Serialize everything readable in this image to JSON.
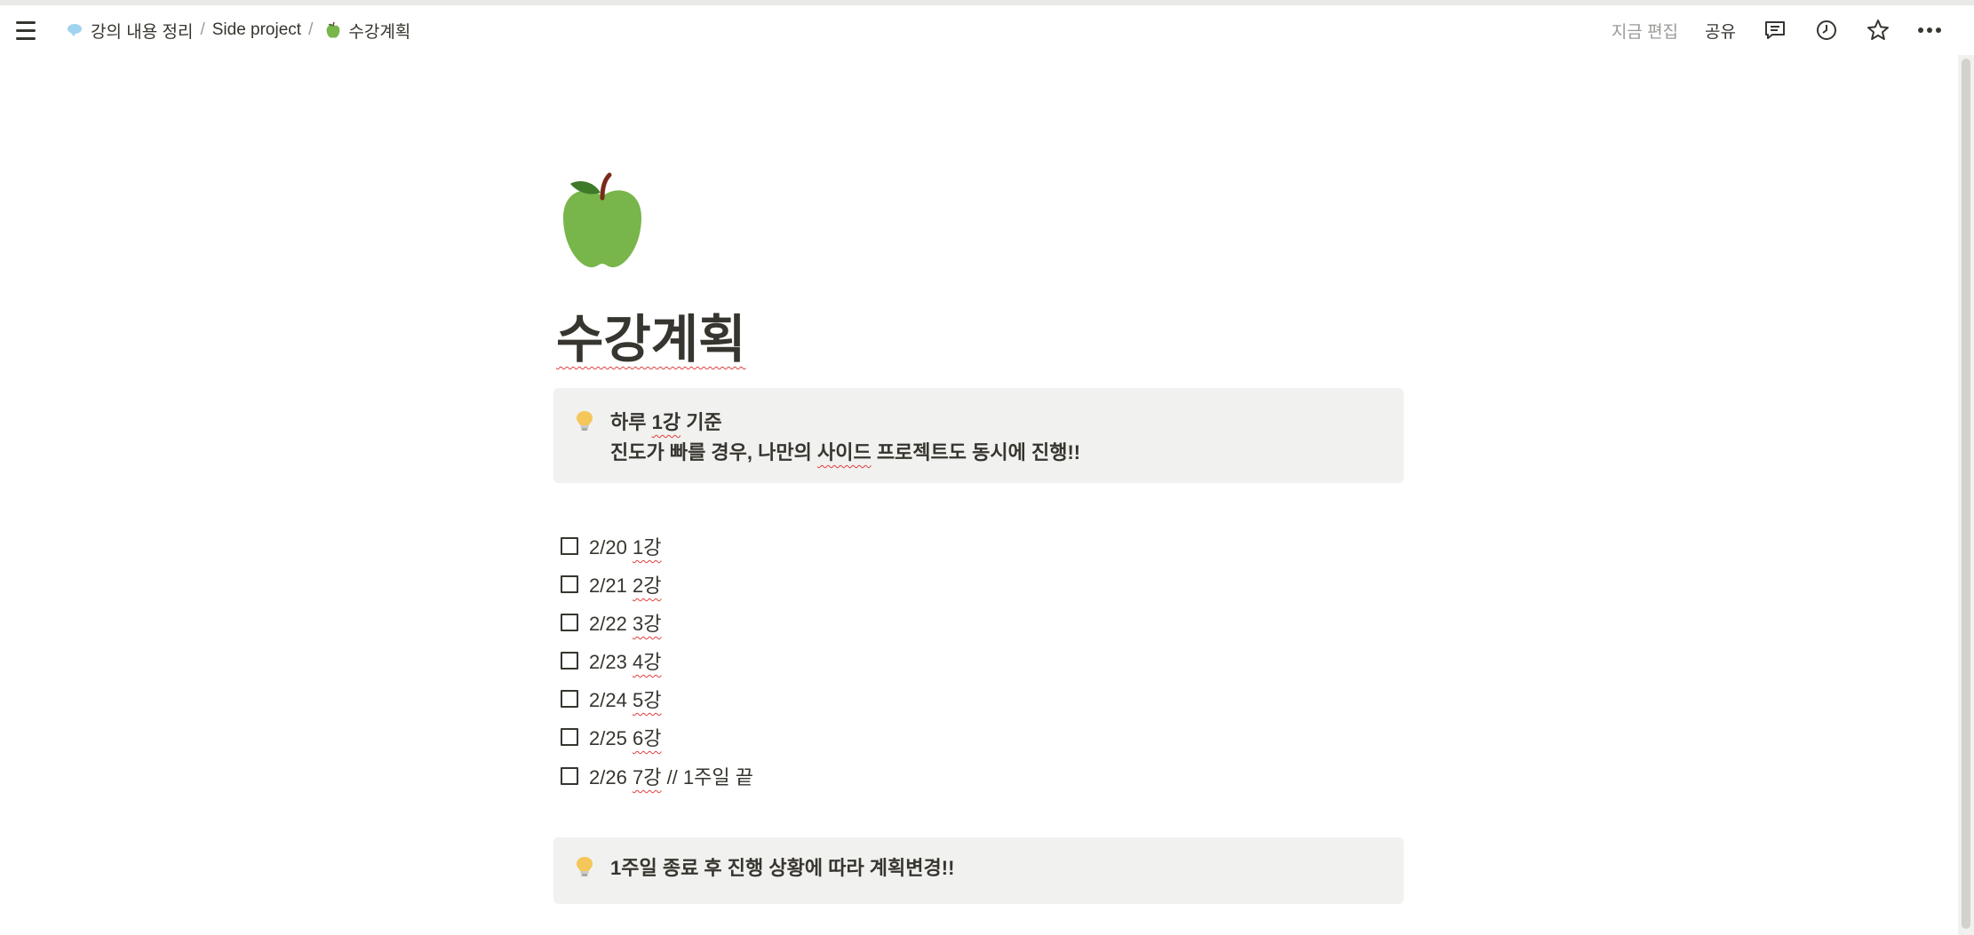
{
  "breadcrumb": {
    "items": [
      {
        "label": "강의 내용 정리",
        "icon": "speech-bubble-icon"
      },
      {
        "label": "Side project",
        "icon": ""
      },
      {
        "label": "수강계획",
        "icon": "green-apple-icon"
      }
    ],
    "separator": "/"
  },
  "topbar": {
    "edit_label": "지금 편집",
    "share_label": "공유",
    "icons": [
      "comment-icon",
      "clock-icon",
      "star-icon",
      "more-icon"
    ]
  },
  "page": {
    "icon": "green-apple",
    "title": "수강계획",
    "callout1": {
      "icon": "lightbulb-icon",
      "line1_prefix": "하루 ",
      "line1_mark": "1강",
      "line1_suffix": " 기준",
      "line2_prefix": "진도가 빠를 경우, 나만의 ",
      "line2_mark": "사이드",
      "line2_suffix": " 프로젝트도 동시에 진행!!"
    },
    "todos": [
      {
        "date": "2/20",
        "lecture": "1강",
        "note": "",
        "checked": false
      },
      {
        "date": "2/21",
        "lecture": "2강",
        "note": "",
        "checked": false
      },
      {
        "date": "2/22",
        "lecture": "3강",
        "note": "",
        "checked": false
      },
      {
        "date": "2/23",
        "lecture": "4강",
        "note": "",
        "checked": false
      },
      {
        "date": "2/24",
        "lecture": "5강",
        "note": "",
        "checked": false
      },
      {
        "date": "2/25",
        "lecture": "6강",
        "note": "",
        "checked": false
      },
      {
        "date": "2/26",
        "lecture": "7강",
        "note": "// 1주일 끝",
        "checked": false
      }
    ],
    "callout2": {
      "icon": "lightbulb-icon",
      "text": "1주일 종료 후 진행 상황에 따라 계획변경!!"
    }
  },
  "colors": {
    "text": "#37352f",
    "muted": "#9b9a97",
    "callout_bg": "#f1f1ef",
    "apple": "#78b54a"
  }
}
